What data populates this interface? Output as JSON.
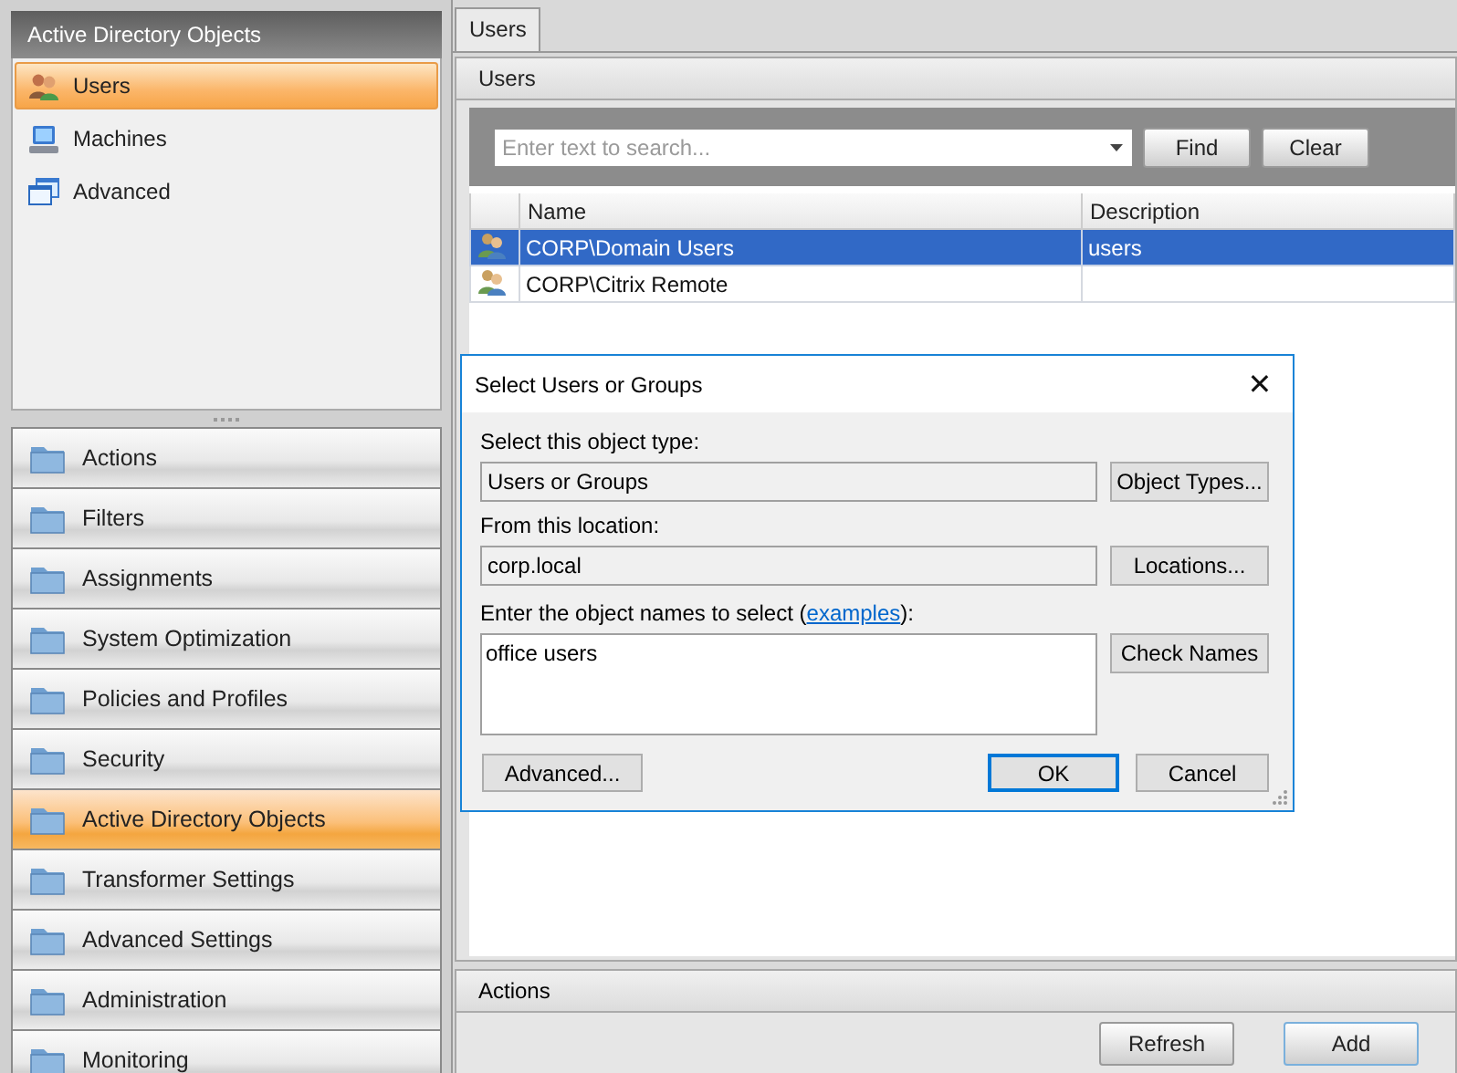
{
  "sidebar": {
    "header": "Active Directory Objects",
    "items": [
      {
        "label": "Users",
        "kind": "users",
        "selected": true
      },
      {
        "label": "Machines",
        "kind": "computer",
        "selected": false
      },
      {
        "label": "Advanced",
        "kind": "windows",
        "selected": false
      }
    ],
    "sections": [
      {
        "label": "Actions",
        "selected": false
      },
      {
        "label": "Filters",
        "selected": false
      },
      {
        "label": "Assignments",
        "selected": false
      },
      {
        "label": "System Optimization",
        "selected": false
      },
      {
        "label": "Policies and Profiles",
        "selected": false
      },
      {
        "label": "Security",
        "selected": false
      },
      {
        "label": "Active Directory Objects",
        "selected": true
      },
      {
        "label": "Transformer Settings",
        "selected": false
      },
      {
        "label": "Advanced Settings",
        "selected": false
      },
      {
        "label": "Administration",
        "selected": false
      },
      {
        "label": "Monitoring",
        "selected": false
      }
    ]
  },
  "tabs": [
    {
      "label": "Users",
      "selected": true
    }
  ],
  "users_panel": {
    "title": "Users",
    "search": {
      "placeholder": "Enter text to search..."
    },
    "find_button": "Find",
    "clear_button": "Clear",
    "table": {
      "columns": [
        "Name",
        "Description"
      ],
      "rows": [
        {
          "name": "CORP\\Domain Users",
          "description": "users",
          "selected": true
        },
        {
          "name": "CORP\\Citrix Remote",
          "selected": false
        }
      ]
    }
  },
  "actions": {
    "title": "Actions",
    "buttons": [
      "Refresh",
      "Add"
    ]
  },
  "dialog": {
    "title": "Select Users or Groups",
    "close": "✕",
    "object_type_label": "Select this object type:",
    "object_type": "Users or Groups",
    "object_types_button": "Object Types...",
    "location_label": "From this location:",
    "location": "corp.local",
    "locations_button": "Locations...",
    "names_label": "Enter the object names to select (",
    "names_link": "examples",
    "names_label_end": "):",
    "names_value": "office users",
    "check_names_button": "Check Names",
    "advanced_button": "Advanced...",
    "ok_button": "OK",
    "cancel_button": "Cancel"
  }
}
